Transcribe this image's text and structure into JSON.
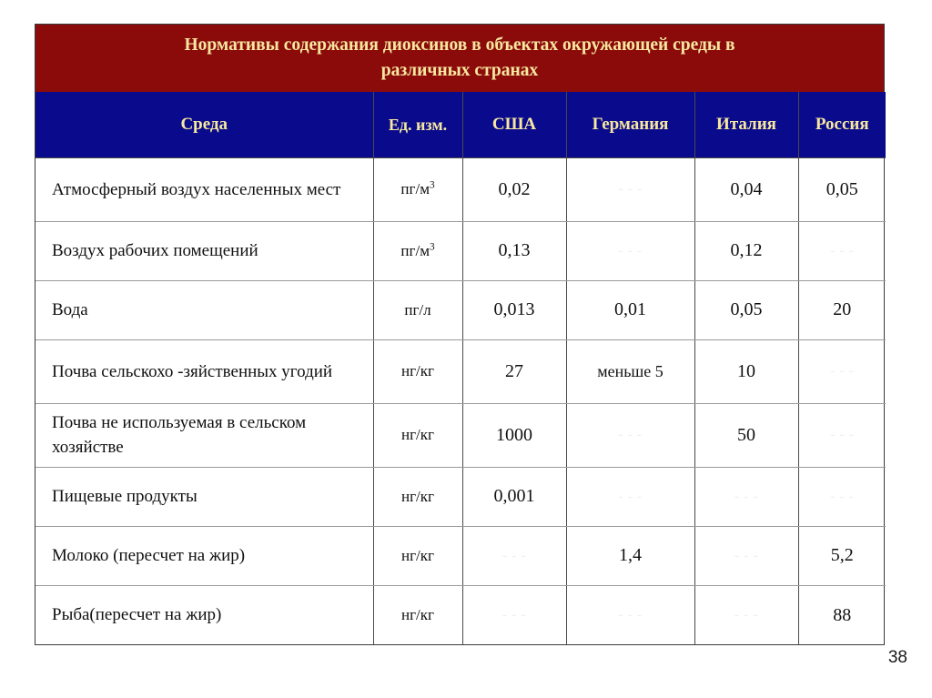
{
  "slide": {
    "title_line1": "Нормативы содержания диоксинов в объектах окружающей среды в",
    "title_line2": "различных странах",
    "page_number": "38",
    "colors": {
      "title_band": "#8B0B0B",
      "title_text": "#F7E8A0",
      "header_band": "#0A0A8C",
      "header_text": "#F7E8A0",
      "body_text": "#111111",
      "empty_dash": "#EFEFEF",
      "page_background": "#FFFFFF"
    }
  },
  "table": {
    "columns": [
      {
        "key": "env",
        "label": "Среда"
      },
      {
        "key": "unit",
        "label": "Ед. изм."
      },
      {
        "key": "usa",
        "label": "США"
      },
      {
        "key": "ger",
        "label": "Германия"
      },
      {
        "key": "ita",
        "label": "Италия"
      },
      {
        "key": "rus",
        "label": "Россия"
      }
    ],
    "unit_superscript": "3",
    "empty_marker": "- - -",
    "rows": [
      {
        "env": "Атмосферный воздух населенных мест",
        "unit_base": "пг/м",
        "unit_sup": "3",
        "usa": "0,02",
        "ger": "- - -",
        "ita": "0,04",
        "rus": "0,05"
      },
      {
        "env": "Воздух рабочих помещений",
        "unit_base": "пг/м",
        "unit_sup": "3",
        "usa": "0,13",
        "ger": "- - -",
        "ita": "0,12",
        "rus": "- - -"
      },
      {
        "env": "Вода",
        "unit_base": "пг/л",
        "unit_sup": "",
        "usa": "0,013",
        "ger": "0,01",
        "ita": "0,05",
        "rus": "20"
      },
      {
        "env": "Почва сельскохо -зяйственных угодий",
        "unit_base": "нг/кг",
        "unit_sup": "",
        "usa": "27",
        "ger": "меньше 5",
        "ita": "10",
        "rus": "- - -"
      },
      {
        "env": "Почва не используемая в сельском хозяйстве",
        "unit_base": "нг/кг",
        "unit_sup": "",
        "usa": "1000",
        "ger": "- - -",
        "ita": "50",
        "rus": "- - -"
      },
      {
        "env": "Пищевые продукты",
        "unit_base": "нг/кг",
        "unit_sup": "",
        "usa": "0,001",
        "ger": "- - -",
        "ita": "- - -",
        "rus": "- - -"
      },
      {
        "env": "Молоко (пересчет на жир)",
        "unit_base": "нг/кг",
        "unit_sup": "",
        "usa": "- - -",
        "ger": "1,4",
        "ita": "- - -",
        "rus": "5,2"
      },
      {
        "env": "Рыба(пересчет на жир)",
        "unit_base": "нг/кг",
        "unit_sup": "",
        "usa": "- - -",
        "ger": "- - -",
        "ita": "- - -",
        "rus": "88"
      }
    ]
  }
}
